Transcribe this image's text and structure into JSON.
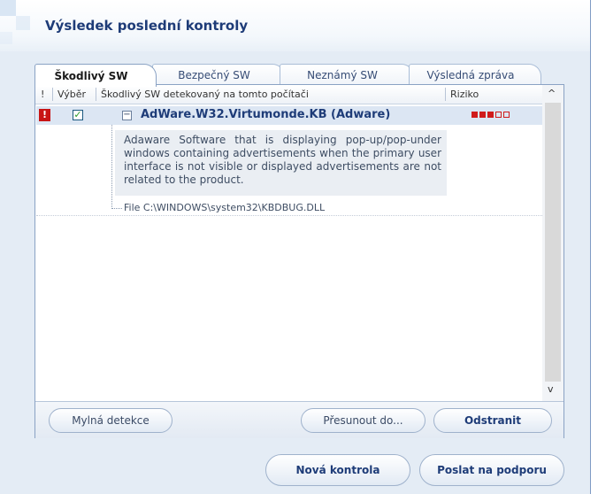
{
  "page": {
    "title": "Výsledek poslední kontroly"
  },
  "tabs": [
    {
      "label": "Škodlivý SW",
      "active": true
    },
    {
      "label": "Bezpečný SW",
      "active": false
    },
    {
      "label": "Neznámý SW",
      "active": false
    },
    {
      "label": "Výsledná zpráva",
      "active": false
    }
  ],
  "table": {
    "headers": {
      "flag": "!",
      "select": "Výběr",
      "name": "Škodlivý SW detekovaný na tomto počítači",
      "risk": "Riziko"
    },
    "rows": [
      {
        "flag": "!",
        "selected": true,
        "checkmark": "✓",
        "expander": "−",
        "name": "AdWare.W32.Virtumonde.KB (Adware)",
        "risk_level": 3,
        "risk_max": 5,
        "description": "Adaware Software that is displaying pop-up/pop-under windows containing advertisements when the primary user interface is not visible or displayed advertisements are not related to the product.",
        "file": "File C:\\WINDOWS\\system32\\KBDBUG.DLL"
      }
    ]
  },
  "scrollbar": {
    "up": "^",
    "down": "v"
  },
  "panel_buttons": {
    "false_detection": "Mylná detekce",
    "move_to": "Přesunout do...",
    "remove": "Odstranit"
  },
  "footer_buttons": {
    "new_scan": "Nová kontrola",
    "send_support": "Poslat na podporu"
  },
  "colors": {
    "accent": "#1e3c78",
    "risk": "#d01b1b",
    "selected_row": "#dce6f3",
    "background": "#e4ecf5"
  },
  "icons": {
    "flag": "alert-icon",
    "checkbox": "checkbox-checked-icon",
    "expander": "collapse-icon",
    "risk": "risk-meter-icon"
  }
}
